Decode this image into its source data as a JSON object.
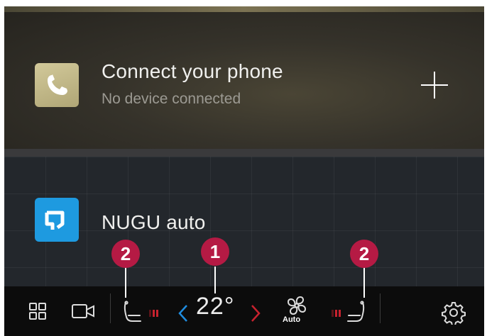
{
  "phone_card": {
    "title": "Connect your phone",
    "subtitle": "No device connected",
    "icon": "phone-icon",
    "action_icon": "plus-icon"
  },
  "nugu_card": {
    "title": "NUGU auto",
    "icon": "nugu-icon"
  },
  "climate_bar": {
    "temperature": "22°",
    "fan_label": "Auto",
    "icons": [
      "app-grid-icon",
      "camera-icon",
      "driver-seat-icon",
      "chevron-left-icon",
      "chevron-right-icon",
      "fan-icon",
      "passenger-seat-icon",
      "settings-gear-icon"
    ]
  },
  "callouts": {
    "temperature": "1",
    "seat_left": "2",
    "seat_right": "2"
  },
  "colors": {
    "accent_blue": "#1f8de0",
    "accent_red": "#c8222e",
    "badge": "#b51a44",
    "nugu_icon_bg": "#1e9ae0"
  }
}
